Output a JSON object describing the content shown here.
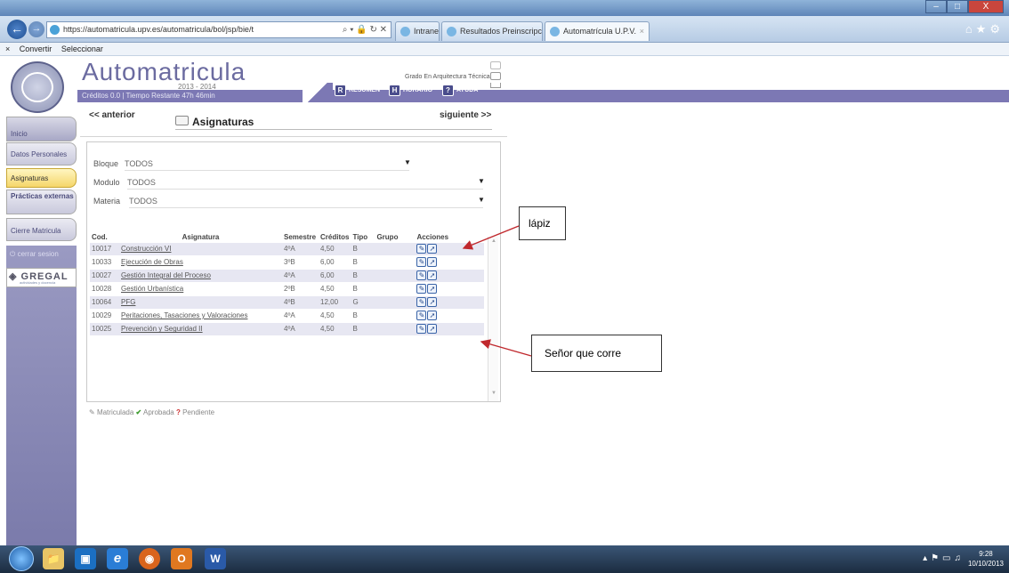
{
  "browser": {
    "address": "https://automatricula.upv.es/automatricula/bol/jsp/bie/t",
    "address_tail": "⌕ ▾ 🔒 ↻ ✕",
    "tabs": [
      {
        "label": "Intranet UPV"
      },
      {
        "label": "Resultados Preinscripci..."
      },
      {
        "label": "Automatrícula U.P.V."
      }
    ],
    "cmd": {
      "convert": "Convertir",
      "select": "Seleccionar"
    },
    "window_controls": [
      "–",
      "□",
      "X"
    ]
  },
  "header": {
    "app_title": "Automatricula",
    "year": "2013 - 2014",
    "credits": "Créditos 0.0 | Tiempo Restante 47h 46min",
    "degree": "Grado En Arquitectura Técnica",
    "buttons": [
      {
        "icon": "R",
        "label": "RESUMEN"
      },
      {
        "icon": "H",
        "label": "HORARIO"
      },
      {
        "icon": "?",
        "label": "AYUDA"
      }
    ]
  },
  "sidebar": {
    "items": [
      {
        "label": "Inicio"
      },
      {
        "label": "Datos Personales"
      },
      {
        "label": "Asignaturas"
      },
      {
        "label": "Prácticas externas"
      },
      {
        "label": "Cierre Matricula"
      }
    ],
    "logout": "cerrar sesion",
    "brand": "GREGAL",
    "brand_sub": "actividades y docencia"
  },
  "main": {
    "prev": "<< anterior",
    "next": "siguiente >>",
    "section_title": "Asignaturas",
    "filters": [
      {
        "label": "Bloque",
        "value": "TODOS"
      },
      {
        "label": "Modulo",
        "value": "TODOS"
      },
      {
        "label": "Materia",
        "value": "TODOS"
      }
    ],
    "columns": {
      "cod": "Cod.",
      "asignatura": "Asignatura",
      "semestre": "Semestre",
      "creditos": "Créditos",
      "tipo": "Tipo",
      "grupo": "Grupo",
      "acciones": "Acciones"
    },
    "rows": [
      {
        "cod": "10017",
        "asignatura": "Construcción VI",
        "semestre": "4ºA",
        "creditos": "4,50",
        "tipo": "B"
      },
      {
        "cod": "10033",
        "asignatura": "Ejecución de Obras",
        "semestre": "3ºB",
        "creditos": "6,00",
        "tipo": "B"
      },
      {
        "cod": "10027",
        "asignatura": "Gestión Integral del Proceso",
        "semestre": "4ºA",
        "creditos": "6,00",
        "tipo": "B"
      },
      {
        "cod": "10028",
        "asignatura": "Gestión Urbanística",
        "semestre": "2ºB",
        "creditos": "4,50",
        "tipo": "B"
      },
      {
        "cod": "10064",
        "asignatura": "PFG",
        "semestre": "4ºB",
        "creditos": "12,00",
        "tipo": "G"
      },
      {
        "cod": "10029",
        "asignatura": "Peritaciones, Tasaciones y Valoraciones",
        "semestre": "4ºA",
        "creditos": "4,50",
        "tipo": "B"
      },
      {
        "cod": "10025",
        "asignatura": "Prevención y Seguridad II",
        "semestre": "4ºA",
        "creditos": "4,50",
        "tipo": "B"
      }
    ],
    "legend": {
      "matriculada": "Matriculada",
      "aprobada": "Aprobada",
      "pendiente": "Pendiente"
    }
  },
  "annotations": {
    "lapiz": "lápiz",
    "corre": "Señor que corre"
  },
  "taskbar": {
    "apps": [
      "📁",
      "▣",
      "e",
      "◉",
      "O",
      "W"
    ],
    "time": "9:28",
    "date": "10/10/2013"
  },
  "colors": {
    "accent": "#7c78b4",
    "active_tab": "#f5d66a",
    "annotation_arrow": "#c0282d"
  }
}
